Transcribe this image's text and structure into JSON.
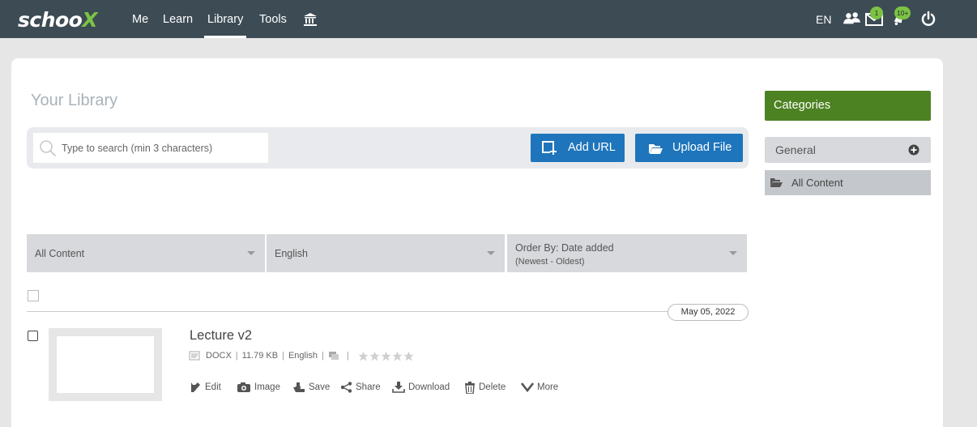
{
  "nav": {
    "brand_main": "schoo",
    "brand_x": "X",
    "links": [
      "Me",
      "Learn",
      "Library",
      "Tools"
    ],
    "active": "Library",
    "language": "EN",
    "messages_badge": "1",
    "notifications_badge": "10+",
    "icons": [
      "museum-icon",
      "groups-icon",
      "envelope-icon",
      "bell-icon",
      "power-icon"
    ]
  },
  "library": {
    "title": "Your Library",
    "search_placeholder": "Type to search (min 3 characters)",
    "add_url_label": "Add URL",
    "upload_file_label": "Upload File"
  },
  "filters": {
    "content": "All Content",
    "language": "English",
    "order_line1": "Order By: Date added",
    "order_line2": "(Newest - Oldest)"
  },
  "date_group": "May 05, 2022",
  "item": {
    "title": "Lecture v2",
    "type": "DOCX",
    "size": "11.79 KB",
    "language": "English",
    "rating_stars": 0,
    "rating_max": 5,
    "actions": [
      "Edit",
      "Image",
      "Save",
      "Share",
      "Download",
      "Delete",
      "More"
    ]
  },
  "sidebar": {
    "categories_title": "Categories",
    "general_label": "General",
    "all_content_label": "All Content"
  },
  "colors": {
    "nav_bg": "#3c4b54",
    "brand_green": "#7cc243",
    "primary_blue": "#1e75bb",
    "category_green": "#4d8222"
  }
}
